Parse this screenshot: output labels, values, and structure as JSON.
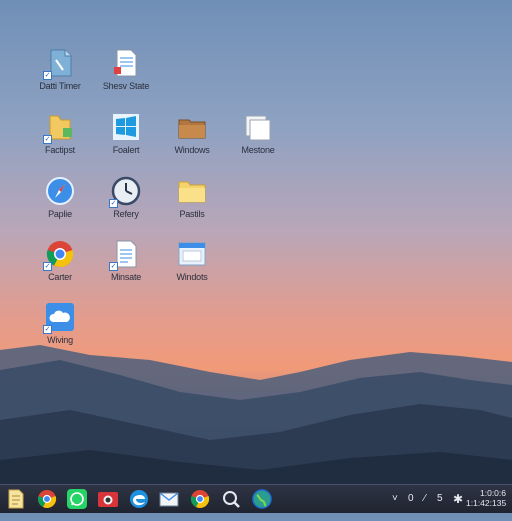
{
  "desktop": {
    "icons": [
      {
        "label": "Datti Timer",
        "icon": "file-icon",
        "checked": true
      },
      {
        "label": "Shesv State",
        "icon": "document-icon",
        "checked": false
      },
      {
        "label": "Factipst",
        "icon": "folder-icon",
        "checked": true
      },
      {
        "label": "Foalert",
        "icon": "windows-icon",
        "checked": false
      },
      {
        "label": "Windows",
        "icon": "briefcase-folder-icon",
        "checked": false
      },
      {
        "label": "Mestone",
        "icon": "stacked-files-icon",
        "checked": false
      },
      {
        "label": "Paplie",
        "icon": "compass-icon",
        "checked": false
      },
      {
        "label": "Refery",
        "icon": "clock-icon",
        "checked": true
      },
      {
        "label": "Pastils",
        "icon": "folder-icon",
        "checked": false
      },
      {
        "label": "Carter",
        "icon": "chrome-icon",
        "checked": true
      },
      {
        "label": "Minsate",
        "icon": "text-document-icon",
        "checked": true
      },
      {
        "label": "Windots",
        "icon": "window-folder-icon",
        "checked": false
      },
      {
        "label": "Wiving",
        "icon": "cloud-icon",
        "checked": true
      }
    ]
  },
  "taskbar": {
    "apps": [
      "file-explorer-icon",
      "chrome-icon",
      "whatsapp-icon",
      "camera-icon",
      "edge-icon",
      "mail-icon",
      "chrome-icon",
      "search-icon",
      "globe-icon"
    ],
    "tray": {
      "chevron": "˅",
      "value_a": "0",
      "separator": "⁄",
      "value_b": "5",
      "settings_glyph": "✱"
    },
    "clock": {
      "line1": "1:0:0:6",
      "line2": "1:1:42:135"
    }
  },
  "colors": {
    "taskbar_bg": "#232937",
    "sky_top": "#6f8fb6",
    "sunset": "#f19a78"
  }
}
